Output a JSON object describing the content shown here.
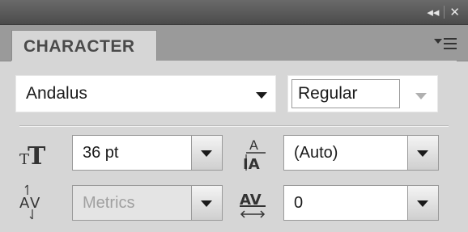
{
  "titlebar": {
    "collapse_glyph": "◂◂",
    "close_glyph": "✕"
  },
  "panel": {
    "tab_label": "CHARACTER",
    "menu_icon": "panel-menu-icon"
  },
  "font_family": {
    "value": "Andalus"
  },
  "font_style": {
    "value": "Regular"
  },
  "font_size": {
    "icon": "font-size-icon",
    "value": "36 pt"
  },
  "leading": {
    "icon": "leading-icon",
    "value": "(Auto)"
  },
  "kerning": {
    "icon": "kerning-icon",
    "value": "Metrics"
  },
  "tracking": {
    "icon": "tracking-icon",
    "value": "0"
  }
}
